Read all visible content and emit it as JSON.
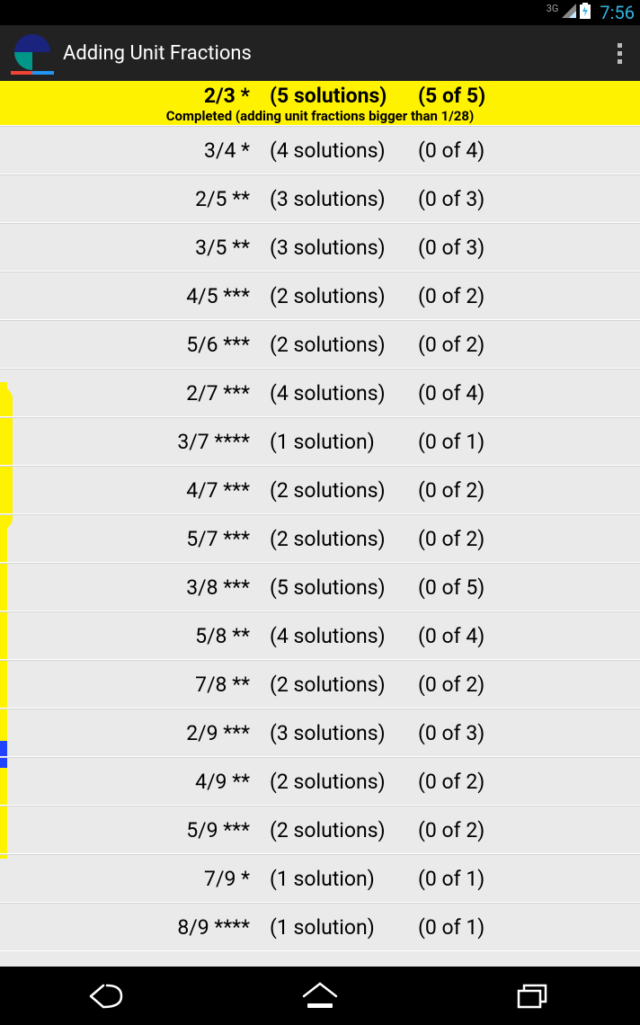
{
  "status": {
    "network": "3G",
    "time": "7:56"
  },
  "header": {
    "title": "Adding Unit Fractions"
  },
  "completed_note": "Completed (adding unit fractions bigger than 1/28)",
  "items": [
    {
      "frac": "2/3 *",
      "sol": "(5 solutions)",
      "prog": "(5 of 5)",
      "completed": true
    },
    {
      "frac": "3/4 *",
      "sol": "(4 solutions)",
      "prog": "(0 of 4)"
    },
    {
      "frac": "2/5 **",
      "sol": "(3 solutions)",
      "prog": "(0 of 3)"
    },
    {
      "frac": "3/5 **",
      "sol": "(3 solutions)",
      "prog": "(0 of 3)"
    },
    {
      "frac": "4/5 ***",
      "sol": "(2 solutions)",
      "prog": "(0 of 2)"
    },
    {
      "frac": "5/6 ***",
      "sol": "(2 solutions)",
      "prog": "(0 of 2)"
    },
    {
      "frac": "2/7 ***",
      "sol": "(4 solutions)",
      "prog": "(0 of 4)"
    },
    {
      "frac": "3/7 ****",
      "sol": "(1 solution)",
      "prog": "(0 of 1)"
    },
    {
      "frac": "4/7 ***",
      "sol": "(2 solutions)",
      "prog": "(0 of 2)"
    },
    {
      "frac": "5/7 ***",
      "sol": "(2 solutions)",
      "prog": "(0 of 2)"
    },
    {
      "frac": "3/8 ***",
      "sol": "(5 solutions)",
      "prog": "(0 of 5)"
    },
    {
      "frac": "5/8 **",
      "sol": "(4 solutions)",
      "prog": "(0 of 4)"
    },
    {
      "frac": "7/8 **",
      "sol": "(2 solutions)",
      "prog": "(0 of 2)"
    },
    {
      "frac": "2/9 ***",
      "sol": "(3 solutions)",
      "prog": "(0 of 3)"
    },
    {
      "frac": "4/9 **",
      "sol": "(2 solutions)",
      "prog": "(0 of 2)"
    },
    {
      "frac": "5/9 ***",
      "sol": "(2 solutions)",
      "prog": "(0 of 2)"
    },
    {
      "frac": "7/9 *",
      "sol": "(1 solution)",
      "prog": "(0 of 1)"
    },
    {
      "frac": "8/9 ****",
      "sol": "(1 solution)",
      "prog": "(0 of 1)"
    }
  ]
}
